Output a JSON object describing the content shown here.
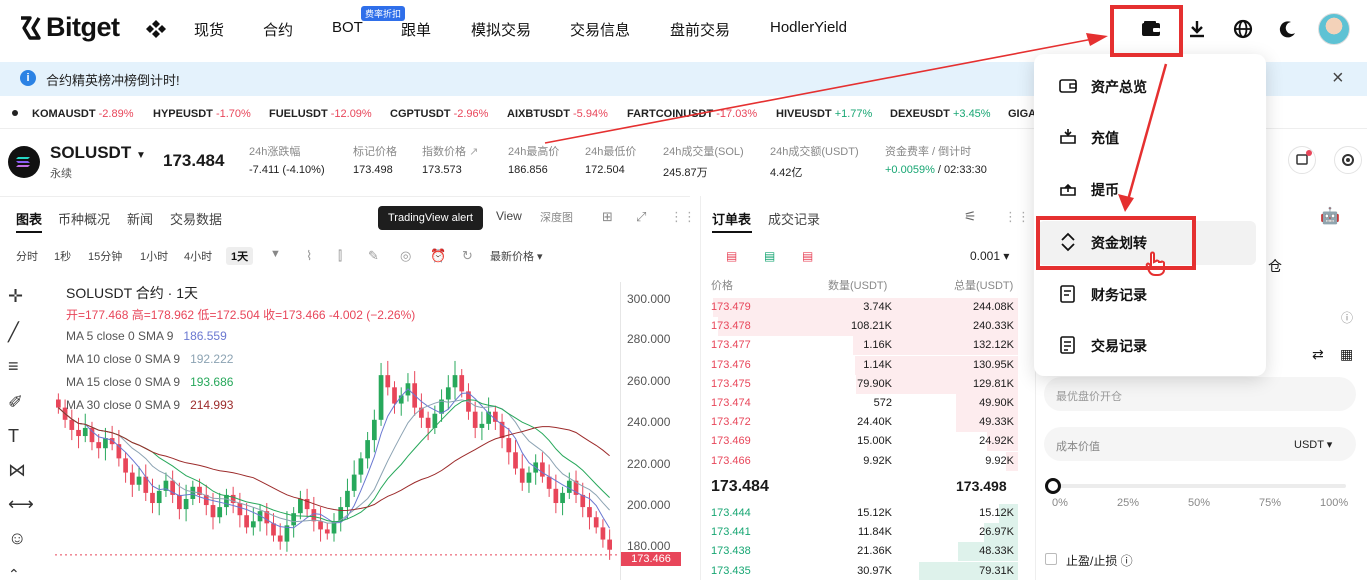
{
  "brand": {
    "name": "Bitget"
  },
  "nav": {
    "items": [
      "现货",
      "合约",
      "BOT",
      "跟单",
      "模拟交易",
      "交易信息",
      "盘前交易",
      "HodlerYield"
    ],
    "bot_badge": "费率折扣"
  },
  "announcement": {
    "text": "合约精英榜冲榜倒计时!"
  },
  "ticker": [
    {
      "symbol": "KOMAUSDT",
      "change": "-2.89%"
    },
    {
      "symbol": "HYPEUSDT",
      "change": "-1.70%"
    },
    {
      "symbol": "FUELUSDT",
      "change": "-12.09%"
    },
    {
      "symbol": "CGPTUSDT",
      "change": "-2.96%"
    },
    {
      "symbol": "AIXBTUSDT",
      "change": "-5.94%"
    },
    {
      "symbol": "FARTCOINUSDT",
      "change": "-17.03%"
    },
    {
      "symbol": "HIVEUSDT",
      "change": "+1.77%"
    },
    {
      "symbol": "DEXEUSDT",
      "change": "+3.45%"
    },
    {
      "symbol": "GIGA",
      "change": ""
    }
  ],
  "symbol": {
    "name": "SOLUSDT",
    "subtitle": "永续",
    "price": "173.484",
    "stats": [
      {
        "label": "24h涨跌幅",
        "value": "-7.411 (-4.10%)"
      },
      {
        "label": "标记价格",
        "value": "173.498"
      },
      {
        "label": "指数价格",
        "value": "173.573"
      },
      {
        "label": "24h最高价",
        "value": "186.856"
      },
      {
        "label": "24h最低价",
        "value": "172.504"
      },
      {
        "label": "24h成交量(SOL)",
        "value": "245.87万"
      },
      {
        "label": "24h成交额(USDT)",
        "value": "4.42亿"
      },
      {
        "label": "资金费率 / 倒计时",
        "value": "+0.0059%",
        "countdown": "/ 02:33:30"
      }
    ]
  },
  "chart_tabs": [
    "图表",
    "币种概况",
    "新闻",
    "交易数据"
  ],
  "chart_view_tabs": [
    "View",
    "深度图"
  ],
  "tooltip": "TradingView alert",
  "timeframes": [
    "分时",
    "1秒",
    "15分钟",
    "1小时",
    "4小时",
    "1天"
  ],
  "latest_price_label": "最新价格",
  "chart": {
    "title": "SOLUSDT 合约 · 1天",
    "ohlc": "开=177.468 高=178.962 低=172.504 收=173.466 -4.002 (−2.26%)",
    "ma": [
      {
        "label": "MA 5 close 0 SMA 9",
        "value": "186.559",
        "color": "#6a78d1"
      },
      {
        "label": "MA 10 close 0 SMA 9",
        "value": "192.222",
        "color": "#8ca3b3"
      },
      {
        "label": "MA 15 close 0 SMA 9",
        "value": "193.686",
        "color": "#27a85b"
      },
      {
        "label": "MA 30 close 0 SMA 9",
        "value": "214.993",
        "color": "#9c2b2b"
      }
    ],
    "y_ticks": [
      "300.000",
      "280.000",
      "260.000",
      "240.000",
      "220.000",
      "200.000",
      "180.000"
    ],
    "last_price": "173.466"
  },
  "orderbook": {
    "tabs": [
      "订单表",
      "成交记录"
    ],
    "depth": "0.001",
    "headers": [
      "价格",
      "数量(USDT)",
      "总量(USDT)"
    ],
    "asks": [
      [
        "173.479",
        "3.74K",
        "244.08K"
      ],
      [
        "173.478",
        "108.21K",
        "240.33K"
      ],
      [
        "173.477",
        "1.16K",
        "132.12K"
      ],
      [
        "173.476",
        "1.14K",
        "130.95K"
      ],
      [
        "173.475",
        "79.90K",
        "129.81K"
      ],
      [
        "173.474",
        "572",
        "49.90K"
      ],
      [
        "173.472",
        "24.40K",
        "49.33K"
      ],
      [
        "173.469",
        "15.00K",
        "24.92K"
      ],
      [
        "173.466",
        "9.92K",
        "9.92K"
      ]
    ],
    "mid_price": "173.484",
    "mark_price": "173.498",
    "bids": [
      [
        "173.444",
        "15.12K",
        "15.12K"
      ],
      [
        "173.441",
        "11.84K",
        "26.97K"
      ],
      [
        "173.438",
        "21.36K",
        "48.33K"
      ],
      [
        "173.435",
        "30.97K",
        "79.31K"
      ]
    ]
  },
  "dropdown": {
    "items": [
      {
        "label": "资产总览",
        "icon": "wallet-icon"
      },
      {
        "label": "充值",
        "icon": "deposit-icon"
      },
      {
        "label": "提币",
        "icon": "withdraw-icon"
      },
      {
        "label": "资金划转",
        "icon": "transfer-icon"
      },
      {
        "label": "财务记录",
        "icon": "finance-record-icon"
      },
      {
        "label": "交易记录",
        "icon": "trade-record-icon"
      }
    ]
  },
  "trade_panel": {
    "open_label_fragment": "仓",
    "price_placeholder": "最优盘价开仓",
    "cost_label": "成本价值",
    "currency": "USDT",
    "slider_marks": [
      "0%",
      "25%",
      "50%",
      "75%",
      "100%"
    ],
    "tp_sl": "止盈/止损"
  },
  "colors": {
    "up": "#17a673",
    "down": "#e8465a",
    "highlight": "#e53030",
    "info": "#2b82e4"
  }
}
